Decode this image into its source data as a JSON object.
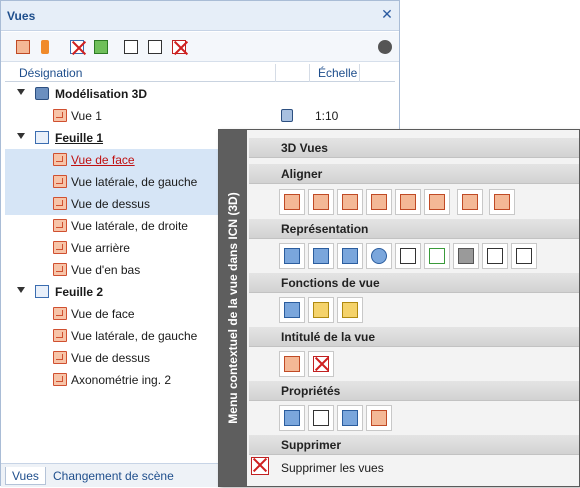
{
  "panel": {
    "title": "Vues",
    "close_glyph": "✕"
  },
  "toolbar": {
    "settings_icon": "gear-icon"
  },
  "table": {
    "headers": {
      "designation": "Désignation",
      "scale": "Échelle"
    },
    "rows": [
      {
        "label": "Modélisation 3D"
      },
      {
        "label": "Vue 1",
        "scale": "1:10"
      },
      {
        "label": "Feuille 1"
      },
      {
        "label": "Vue de face"
      },
      {
        "label": "Vue latérale, de gauche"
      },
      {
        "label": "Vue de dessus"
      },
      {
        "label": "Vue latérale, de droite"
      },
      {
        "label": "Vue arrière"
      },
      {
        "label": "Vue d'en bas"
      },
      {
        "label": "Feuille 2"
      },
      {
        "label": "Vue de face"
      },
      {
        "label": "Vue latérale, de gauche"
      },
      {
        "label": "Vue de dessus"
      },
      {
        "label": "Axonométrie ing. 2"
      }
    ]
  },
  "tabs": [
    "Vues",
    "Changement de scène"
  ],
  "context_menu": {
    "vertical_title": "Menu contextuel de la vue dans ICN (3D)",
    "sections": {
      "views3d": "3D Vues",
      "align": "Aligner",
      "representation": "Représentation",
      "view_functions": "Fonctions de vue",
      "view_title": "Intitulé de la vue",
      "properties": "Propriétés",
      "delete": "Supprimer"
    },
    "delete_label": "Supprimer les vues"
  }
}
